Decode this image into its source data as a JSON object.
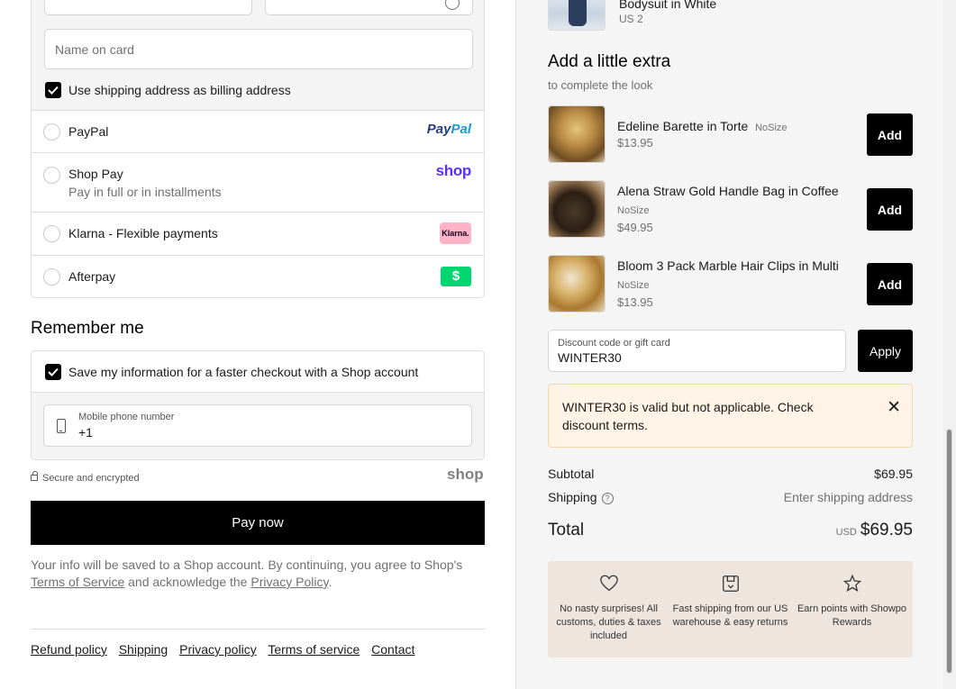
{
  "payment": {
    "name_on_card_placeholder": "Name on card",
    "billing_same_label": "Use shipping address as billing address",
    "methods": [
      {
        "label": "PayPal",
        "sublabel": "",
        "logo_text_1": "Pay",
        "logo_text_2": "Pal"
      },
      {
        "label": "Shop Pay",
        "sublabel": "Pay in full or in installments",
        "logo_text": "shop"
      },
      {
        "label": "Klarna - Flexible payments",
        "sublabel": "",
        "logo_text": "Klarna."
      },
      {
        "label": "Afterpay",
        "sublabel": "",
        "logo_text": "$"
      }
    ]
  },
  "remember": {
    "title": "Remember me",
    "save_label": "Save my information for a faster checkout with a Shop account",
    "phone_label": "Mobile phone number",
    "phone_value": "+1"
  },
  "secure": {
    "text": "Secure and encrypted",
    "logo": "shop"
  },
  "pay_now_label": "Pay now",
  "legal": {
    "part1": "Your info will be saved to a Shop account. By continuing, you agree to Shop's ",
    "terms_link": "Terms of Service",
    "part2": " and acknowledge the ",
    "privacy_link": "Privacy Policy",
    "part3": "."
  },
  "footer_links": [
    "Refund policy",
    "Shipping",
    "Privacy policy",
    "Terms of service",
    "Contact"
  ],
  "cart": {
    "top_item": {
      "name": "Bodysuit in White",
      "size": "US 2"
    },
    "extra_title": "Add a little extra",
    "extra_subtitle": "to complete the look",
    "extras": [
      {
        "name": "Edeline Barette in Torte",
        "size": "NoSize",
        "price": "$13.95",
        "add_label": "Add"
      },
      {
        "name": "Alena Straw Gold Handle Bag in Coffee",
        "size": "NoSize",
        "price": "$49.95",
        "add_label": "Add"
      },
      {
        "name": "Bloom 3 Pack Marble Hair Clips in Multi",
        "size": "NoSize",
        "price": "$13.95",
        "add_label": "Add"
      }
    ],
    "discount_label": "Discount code or gift card",
    "discount_value": "WINTER30",
    "apply_label": "Apply",
    "notice": "WINTER30 is valid but not applicable. Check discount terms.",
    "notice_close": "✕",
    "subtotal_label": "Subtotal",
    "subtotal_value": "$69.95",
    "shipping_label": "Shipping",
    "shipping_value": "Enter shipping address",
    "total_label": "Total",
    "total_currency": "USD",
    "total_value": "$69.95",
    "perks": [
      {
        "icon": "heart-icon",
        "text": "No nasty surprises! All customs, duties & taxes included"
      },
      {
        "icon": "box-icon",
        "text": "Fast shipping from our US warehouse & easy returns"
      },
      {
        "icon": "star-icon",
        "text": "Earn points with Showpo Rewards"
      }
    ]
  },
  "colors": {
    "accent_black": "#000000",
    "shop_purple": "#5a31f4",
    "paypal_dark": "#253b80",
    "paypal_light": "#179bd7",
    "klarna_pink": "#ffb3c7",
    "afterpay_green": "#00d66f",
    "notice_bg": "#fff4e5",
    "perks_bg": "#eee5df"
  }
}
